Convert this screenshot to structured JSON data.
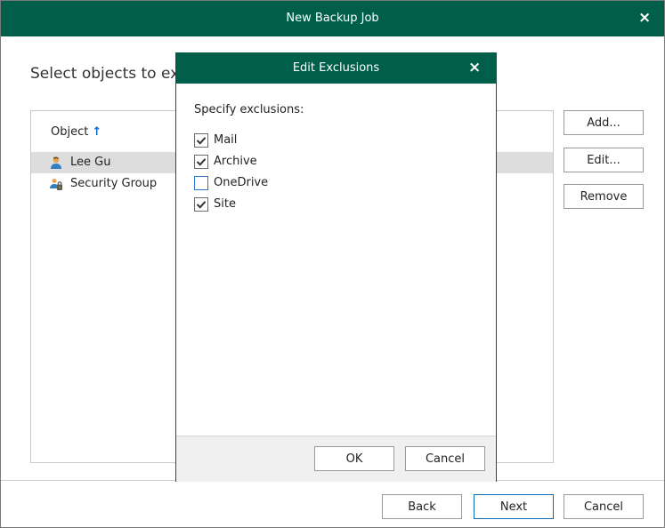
{
  "window": {
    "title": "New Backup Job",
    "close_icon": "×"
  },
  "heading": "Select objects to exc",
  "list": {
    "column_header": "Object",
    "sort_icon": "↑",
    "rows": [
      {
        "label": "Lee Gu",
        "icon": "user-icon",
        "selected": true
      },
      {
        "label": "Security Group",
        "icon": "security-group-icon",
        "selected": false
      }
    ]
  },
  "side_buttons": {
    "add": "Add...",
    "edit": "Edit...",
    "remove": "Remove"
  },
  "footer": {
    "back": "Back",
    "next": "Next",
    "cancel": "Cancel"
  },
  "dialog": {
    "title": "Edit Exclusions",
    "close_icon": "×",
    "prompt": "Specify exclusions:",
    "options": [
      {
        "label": "Mail",
        "checked": true
      },
      {
        "label": "Archive",
        "checked": true
      },
      {
        "label": "OneDrive",
        "checked": false
      },
      {
        "label": "Site",
        "checked": true
      }
    ],
    "ok": "OK",
    "cancel": "Cancel"
  },
  "colors": {
    "titlebar": "#005f4b",
    "accent_blue": "#0a6ab8",
    "selected_row": "#dddddd"
  }
}
